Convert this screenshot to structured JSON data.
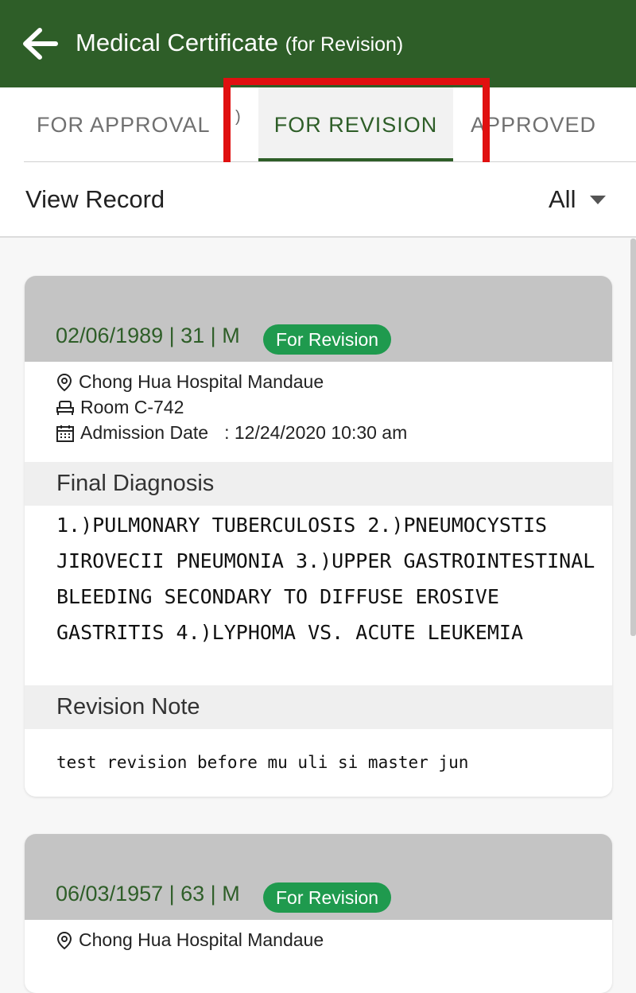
{
  "appbar": {
    "title": "Medical Certificate",
    "subtitle": "(for Revision)"
  },
  "tabs": {
    "for_approval": "FOR APPROVAL",
    "for_revision": "FOR REVISION",
    "approved": "APPROVED",
    "partial_badge": ")"
  },
  "filter": {
    "label": "View Record",
    "value": "All"
  },
  "records": [
    {
      "meta": "02/06/1989 | 31 | M",
      "status": "For Revision",
      "hospital": "Chong Hua Hospital Mandaue",
      "room": "Room C-742",
      "admission_label": "Admission Date",
      "admission_value": ": 12/24/2020 10:30 am",
      "diagnosis_title": "Final Diagnosis",
      "diagnosis": "1.)PULMONARY TUBERCULOSIS 2.)PNEUMOCYSTIS JIROVECII PNEUMONIA 3.)UPPER GASTROINTESTINAL BLEEDING SECONDARY TO DIFFUSE EROSIVE GASTRITIS 4.)LYPHOMA VS. ACUTE LEUKEMIA",
      "note_title": "Revision Note",
      "note": "test revision before mu uli si master jun"
    },
    {
      "meta": "06/03/1957 | 63 | M",
      "status": "For Revision",
      "hospital": "Chong Hua Hospital Mandaue"
    }
  ],
  "colors": {
    "brand": "#2e5e28",
    "badge": "#1f9a4e",
    "highlight": "#e01010"
  },
  "icons": [
    "arrow-left-icon",
    "map-pin-icon",
    "bed-icon",
    "calendar-icon",
    "caret-down-icon"
  ]
}
